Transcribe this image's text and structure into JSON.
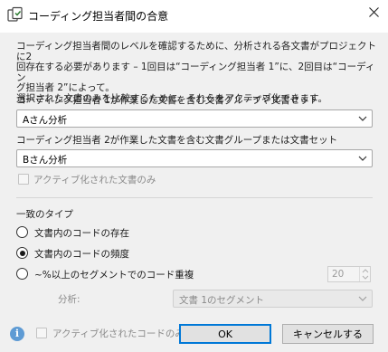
{
  "window": {
    "title": "コーディング担当者間の合意",
    "icon": "intercoder-agreement-icon",
    "close_icon": "close-icon"
  },
  "description": {
    "line1": "コーディング担当者間のレベルを確認するために、分析される各文書がプロジェクトに2",
    "line2": "回存在する必要があります – 1回目は“コーディング担当者 1”に、2回目は“コーディン",
    "line3": "グ担当者 2”によって。",
    "line4": "選択された文書のみを比較するために、それらをアクティブ化できます。"
  },
  "coder1": {
    "label": "コーディング担当者 1が作業した文書を含む文書グループや文書セット",
    "value": "Aさん分析"
  },
  "coder2": {
    "label": "コーディング担当者 2が作業した文書を含む文書グループまたは文書セット",
    "value": "Bさん分析"
  },
  "activated_docs_only": {
    "label": "アクティブ化された文書のみ",
    "checked": false
  },
  "agreement_type": {
    "title": "一致のタイプ",
    "options": [
      {
        "label": "文書内のコードの存在",
        "selected": false
      },
      {
        "label": "文書内のコードの頻度",
        "selected": true
      },
      {
        "label": "~%以上のセグメントでのコード重複",
        "selected": false
      }
    ],
    "overlap_percent": "20",
    "analysis_label": "分析:",
    "analysis_value": "文書 1のセグメント"
  },
  "footer": {
    "info_icon": "info-icon",
    "activated_codes_only": {
      "label": "アクティブ化されたコードのみ",
      "checked": false
    },
    "ok_label": "OK",
    "cancel_label": "キャンセルする"
  }
}
